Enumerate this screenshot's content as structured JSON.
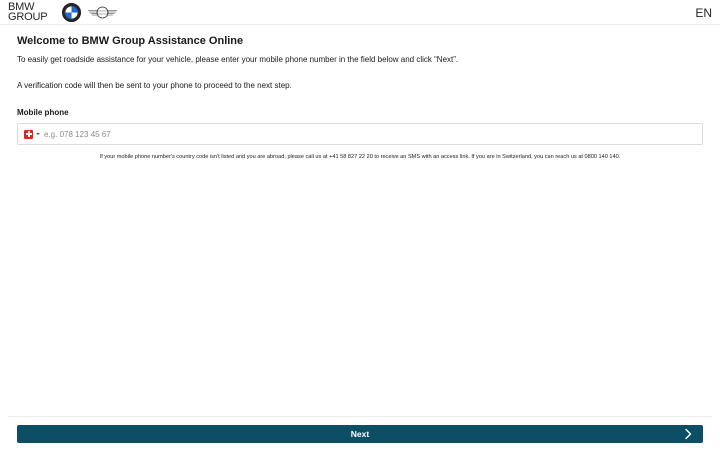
{
  "header": {
    "brand_line1": "BMW",
    "brand_line2": "GROUP",
    "bmw_logo_icon": "bmw-roundel-icon",
    "mini_logo_icon": "mini-wings-icon",
    "language": "EN"
  },
  "main": {
    "title": "Welcome to BMW Group Assistance Online",
    "intro": "To easily get roadside assistance for your vehicle, please enter your mobile phone number in the field below and click “Next”.",
    "intro_verification": "A verification code will then be sent to your phone to proceed to the next step.",
    "mobile_label": "Mobile phone",
    "phone": {
      "country_flag_icon": "switzerland-flag-icon",
      "value": "",
      "placeholder": "e.g. 078 123 45 67"
    },
    "note": "If your mobile phone number's country code isn't listed and you are abroad, please call us at +41 58 827 22 20 to receive an SMS with an access link. If you are in Switzerland, you can reach us at 0800 140 140."
  },
  "footer": {
    "next_label": "Next",
    "next_icon": "chevron-right-icon"
  },
  "colors": {
    "primary_button": "#0c4e64",
    "text": "#1a1a1a"
  }
}
